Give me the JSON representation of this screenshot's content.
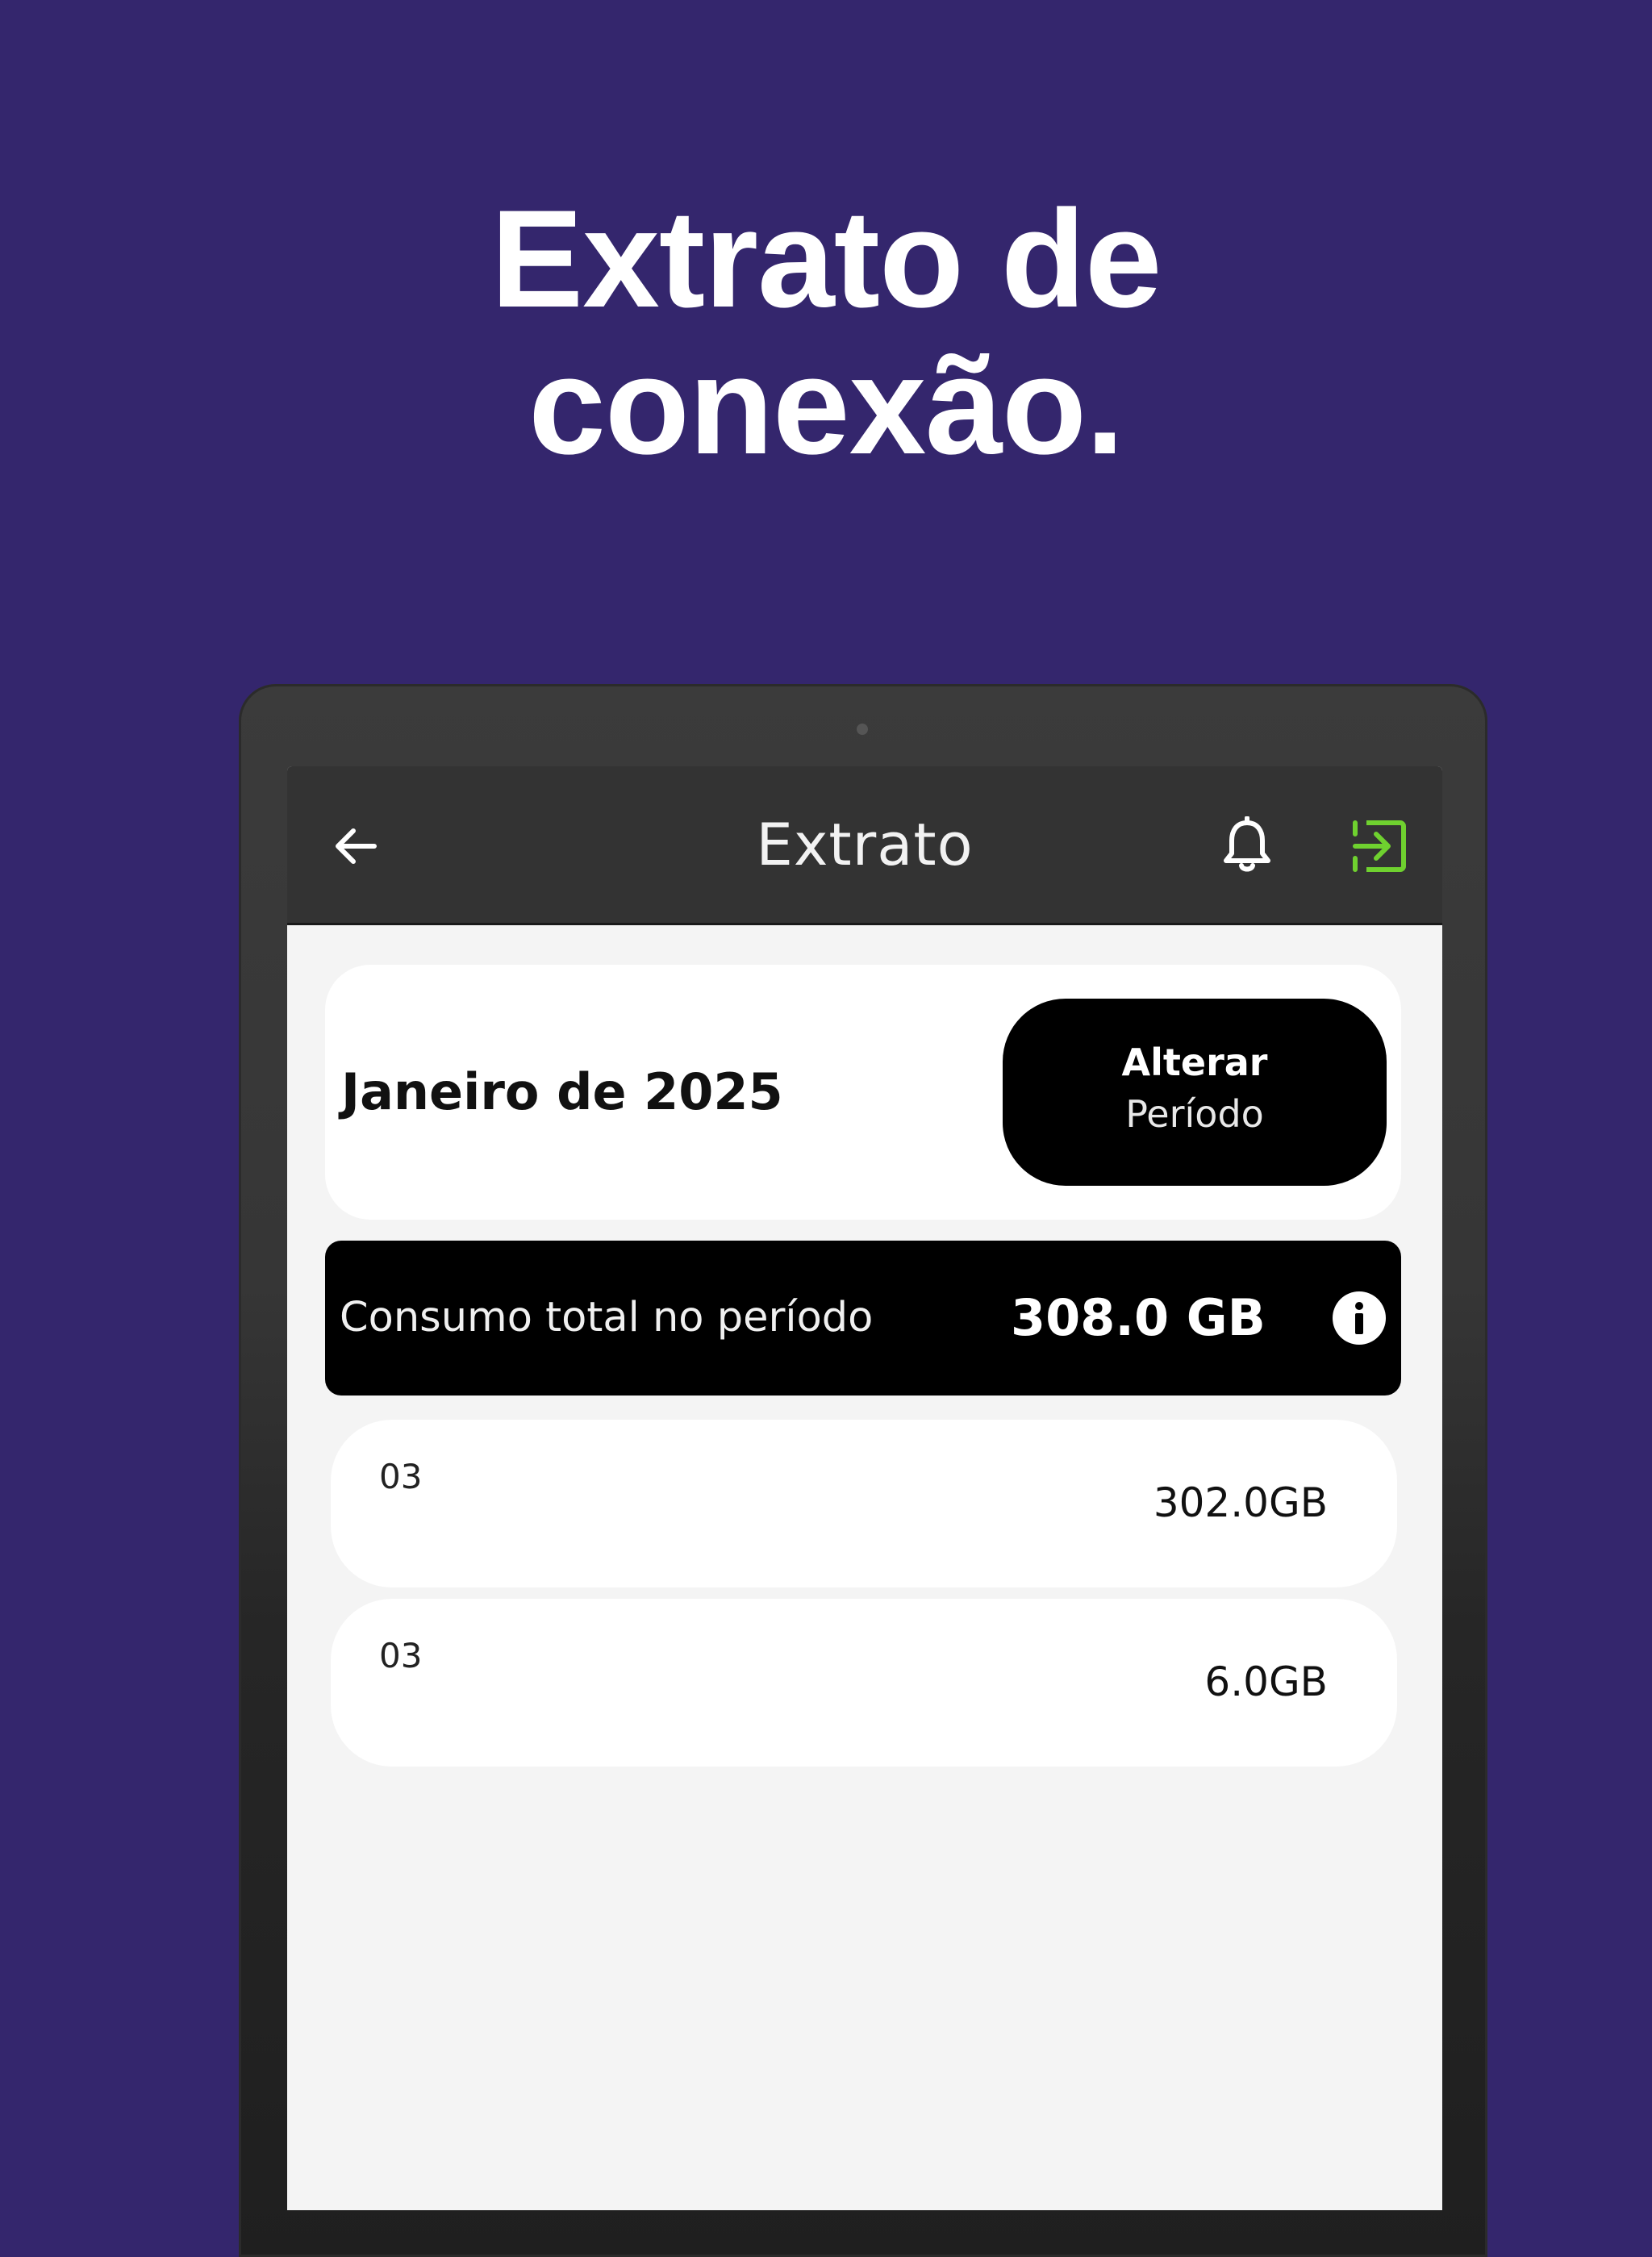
{
  "promo": {
    "headline_line1": "Extrato de",
    "headline_line2": "conexão."
  },
  "colors": {
    "background": "#34266d",
    "appbar": "#333333",
    "screen": "#f4f4f4",
    "accent_green": "#6fd12f",
    "black": "#000000",
    "white": "#ffffff"
  },
  "appbar": {
    "title": "Extrato",
    "back_icon": "arrow-left-icon",
    "bell_icon": "bell-icon",
    "logout_icon": "logout-icon"
  },
  "period": {
    "label": "Janeiro de 2025",
    "button_line1": "Alterar",
    "button_line2": "Período"
  },
  "total": {
    "label": "Consumo total no período",
    "value": "308.0 GB",
    "info_icon": "info-icon"
  },
  "entries": [
    {
      "day": "03",
      "amount": "302.0GB"
    },
    {
      "day": "03",
      "amount": "6.0GB"
    }
  ]
}
